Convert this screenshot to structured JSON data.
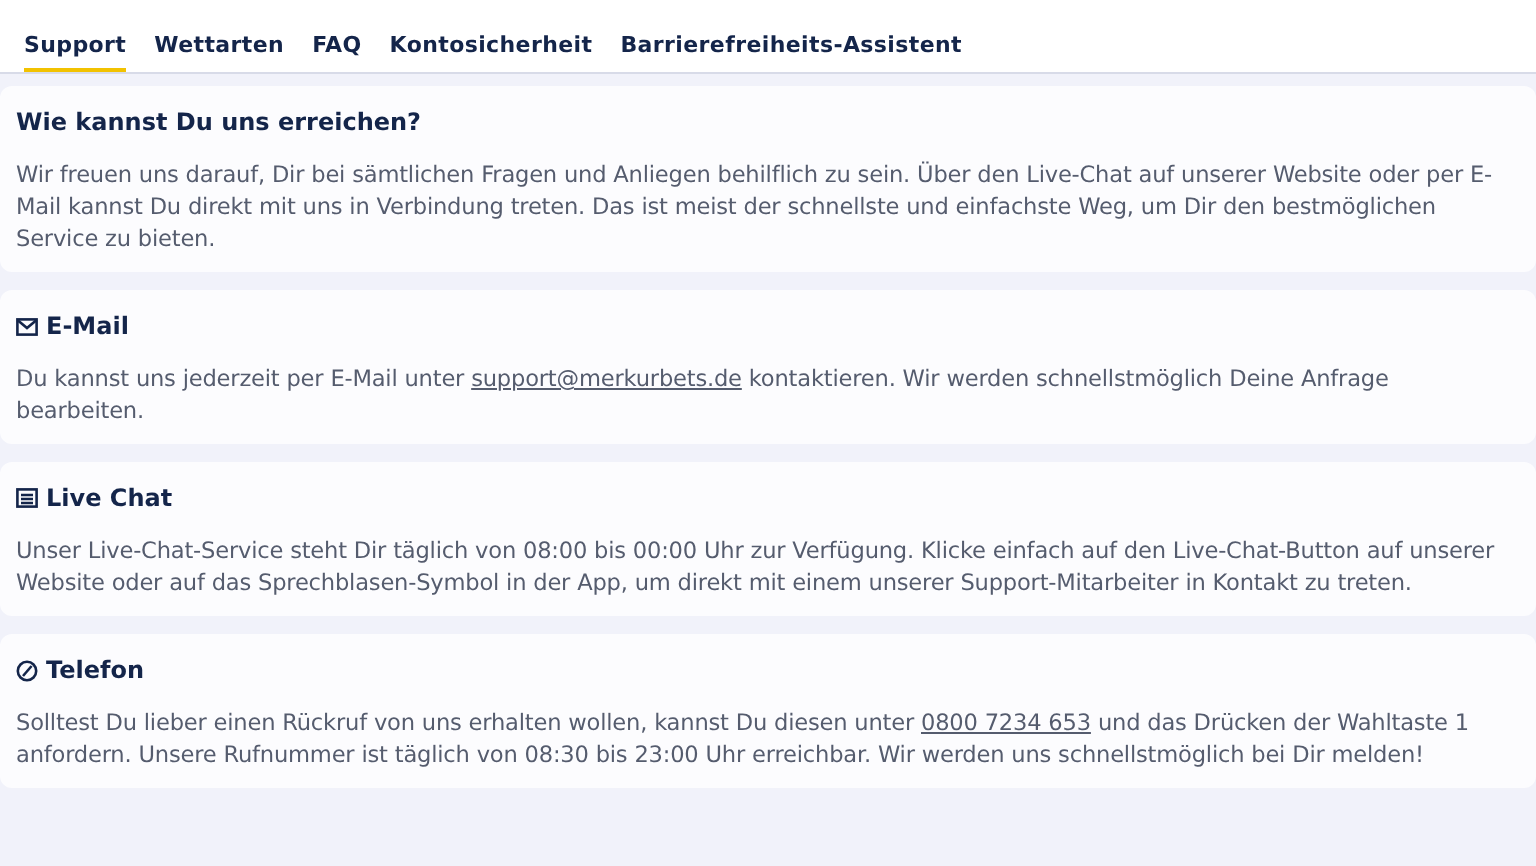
{
  "tabs": [
    {
      "label": "Support",
      "selected": true
    },
    {
      "label": "Wettarten",
      "selected": false
    },
    {
      "label": "FAQ",
      "selected": false
    },
    {
      "label": "Kontosicherheit",
      "selected": false
    },
    {
      "label": "Barrierefreiheits-Assistent",
      "selected": false
    }
  ],
  "sections": [
    {
      "title": "Wie kannst Du uns erreichen?",
      "kind": "intro",
      "body": [
        {
          "kind": "text",
          "text": "Wir freuen uns darauf, Dir bei sämtlichen Fragen und Anliegen behilflich zu sein. Über den Live-Chat auf unserer Website oder per E-Mail kannst Du direkt mit uns in Verbindung treten. Das ist meist der schnellste und einfachste Weg, um Dir den bestmöglichen Service zu bieten."
        }
      ]
    },
    {
      "title": "E-Mail",
      "kind": "email",
      "body": [
        {
          "kind": "text",
          "text": "Du kannst uns jederzeit per E-Mail unter "
        },
        {
          "kind": "link",
          "text": "support@merkurbets.de"
        },
        {
          "kind": "text",
          "text": " kontaktieren. Wir werden schnellstmöglich Deine Anfrage bearbeiten."
        }
      ]
    },
    {
      "title": "Live Chat",
      "kind": "chat",
      "body": [
        {
          "kind": "text",
          "text": "Unser Live-Chat-Service steht Dir täglich von 08:00 bis 00:00 Uhr zur Verfügung. Klicke einfach auf den Live-Chat-Button auf unserer Website oder auf das Sprechblasen-Symbol in der App, um direkt mit einem unserer Support-Mitarbeiter in Kontakt zu treten."
        }
      ]
    },
    {
      "title": "Telefon",
      "kind": "phone",
      "body": [
        {
          "kind": "text",
          "text": "Solltest Du lieber einen Rückruf von uns erhalten wollen, kannst Du diesen unter "
        },
        {
          "kind": "link",
          "text": "0800 7234 653"
        },
        {
          "kind": "text",
          "text": " und das Drücken der Wahltaste 1 anfordern. Unsere Rufnummer ist täglich von 08:30 bis 23:00 Uhr erreichbar. Wir werden uns schnellstmöglich bei Dir melden!"
        }
      ]
    }
  ]
}
